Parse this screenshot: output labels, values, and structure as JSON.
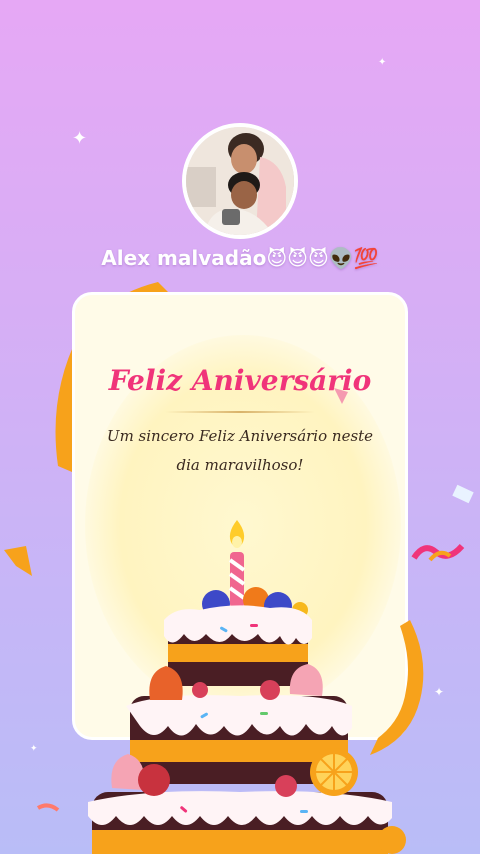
{
  "profile": {
    "username": "Alex malvadão😈😈😈👽💯"
  },
  "card": {
    "title": "Feliz Aniversário",
    "message": "Um sincero Feliz Aniversário neste dia maravilhoso!"
  },
  "decor": {
    "sparkle_glyph": "✦",
    "accent_pink": "#f0347a",
    "ribbon_orange": "#f7a21b",
    "background_top": "#e6a8f5",
    "background_bottom": "#b9bdf7"
  }
}
